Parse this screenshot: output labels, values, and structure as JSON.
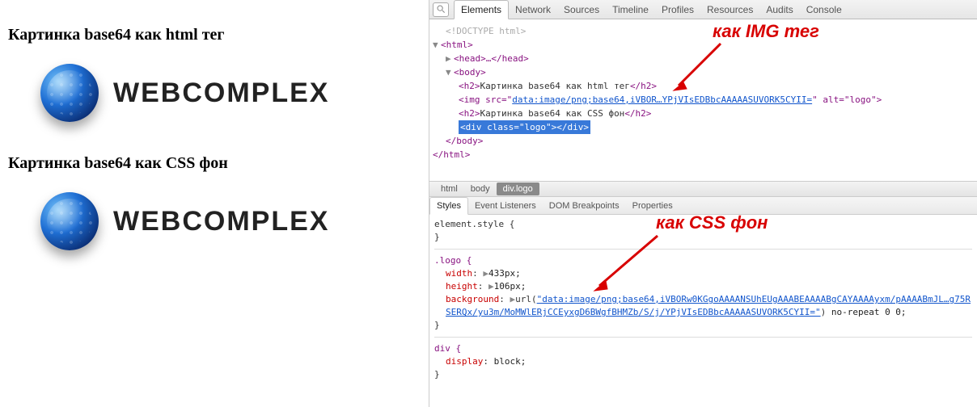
{
  "left": {
    "heading1": "Картинка base64 как html тег",
    "heading2": "Картинка base64 как CSS фон",
    "logo_text": "WEBCOMPLEX"
  },
  "devtools": {
    "tabs": [
      "Elements",
      "Network",
      "Sources",
      "Timeline",
      "Profiles",
      "Resources",
      "Audits",
      "Console"
    ],
    "dom": {
      "doctype": "<!DOCTYPE html>",
      "html_open": "<html>",
      "head_line": "<head>…</head>",
      "body_open": "<body>",
      "h2a_open": "<h2>",
      "h2a_text": "Картинка base64 как html тег",
      "h2a_close": "</h2>",
      "img_prefix": "<img src=\"",
      "img_src": "data:image/png;base64,iVBOR…YPjVIsEDBbcAAAAASUVORK5CYII=",
      "img_suffix": "\" alt=\"logo\">",
      "h2b_open": "<h2>",
      "h2b_text": "Картинка base64 как CSS фон",
      "h2b_close": "</h2>",
      "div_logo": "<div class=\"logo\"></div>",
      "body_close": "</body>",
      "html_close": "</html>"
    },
    "annotations": {
      "img_tag": "как IMG тег",
      "css_bg": "как CSS фон"
    },
    "crumbs": [
      "html",
      "body",
      "div.logo"
    ],
    "styles_tabs": [
      "Styles",
      "Event Listeners",
      "DOM Breakpoints",
      "Properties"
    ],
    "styles": {
      "element_style": "element.style {",
      "close": "}",
      "logo_sel": ".logo {",
      "width_p": "width",
      "width_v": "433px;",
      "height_p": "height",
      "height_v": "106px;",
      "bg_p": "background",
      "bg_url": "\"data:image/png;base64,iVBORw0KGgoAAAANSUhEUgAAABEAAAABgCAYAAAAyxm/pAAAABmJL…g75RSERQx/yu3m/MoMWlERjCCEyxgD6BWgfBHMZb/S/j/YPjVIsEDBbcAAAAASUVORK5CYII=\"",
      "bg_tail": " no-repeat 0 0;",
      "div_sel": "div {",
      "display_p": "display",
      "display_v": "block;"
    }
  }
}
